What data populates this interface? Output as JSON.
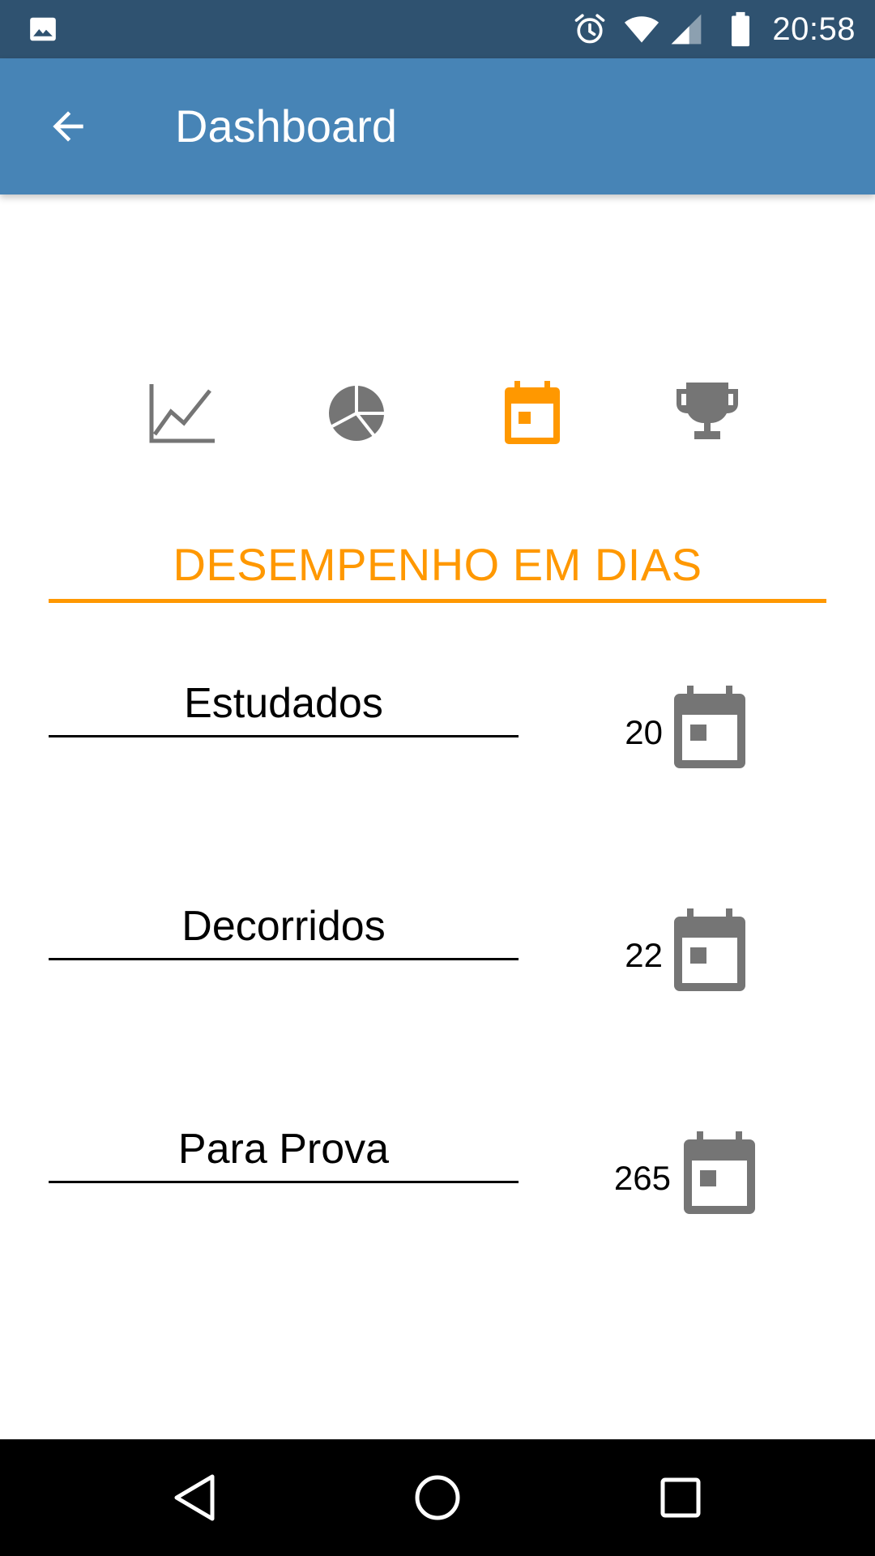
{
  "status_bar": {
    "time": "20:58",
    "icons": [
      "gallery-icon",
      "alarm-icon",
      "wifi-icon",
      "signal-icon",
      "battery-icon"
    ]
  },
  "app_bar": {
    "title": "Dashboard",
    "back_icon": "arrow-back-icon"
  },
  "tabs": [
    {
      "icon": "line-chart-icon",
      "active": false
    },
    {
      "icon": "pie-chart-icon",
      "active": false
    },
    {
      "icon": "calendar-icon",
      "active": true
    },
    {
      "icon": "trophy-icon",
      "active": false
    }
  ],
  "section": {
    "title": "DESEMPENHO EM DIAS"
  },
  "stats": [
    {
      "label": "Estudados",
      "value": "20",
      "icon": "calendar-icon"
    },
    {
      "label": "Decorridos",
      "value": "22",
      "icon": "calendar-icon"
    },
    {
      "label": "Para Prova",
      "value": "265",
      "icon": "calendar-icon"
    }
  ],
  "nav_bar": {
    "buttons": [
      "back-nav-icon",
      "home-nav-icon",
      "recents-nav-icon"
    ]
  },
  "colors": {
    "status_bar": "#2f5270",
    "app_bar": "#4784b6",
    "accent": "#ff9800",
    "icon_inactive": "#757575",
    "nav_bar": "#000000"
  }
}
